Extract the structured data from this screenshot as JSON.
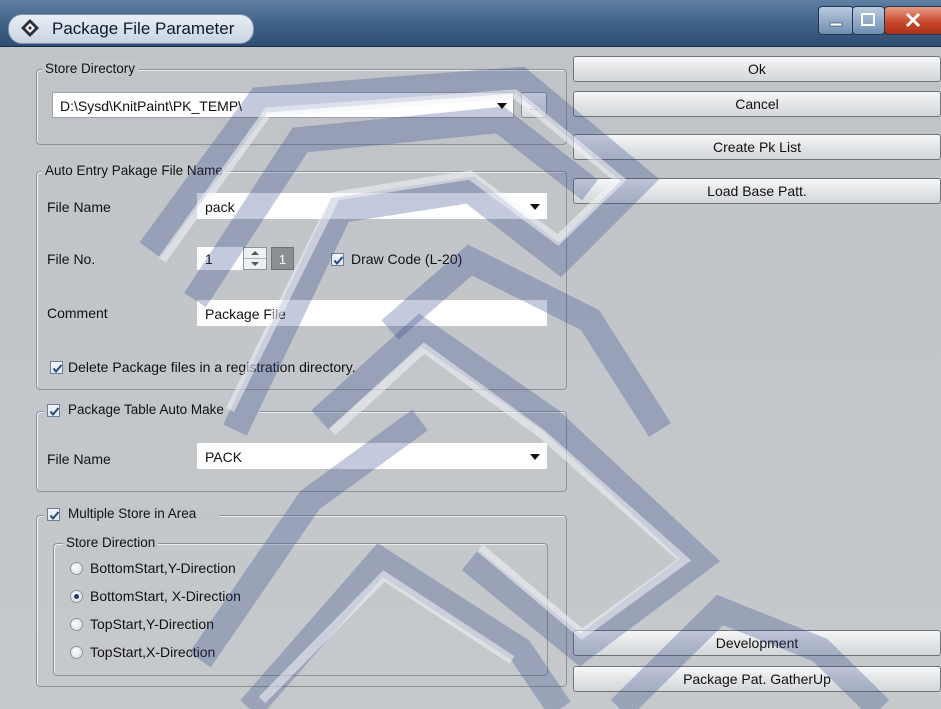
{
  "window": {
    "title": "Package File Parameter"
  },
  "store_directory": {
    "legend": "Store Directory",
    "path": "D:\\Sysd\\KnitPaint\\PK_TEMP\\",
    "browse_label": "..."
  },
  "auto_entry": {
    "legend": "Auto Entry Pakage File Name",
    "file_name_label": "File Name",
    "file_name_value": "pack",
    "file_no_label": "File No.",
    "file_no_value": "1",
    "file_no_badge": "1",
    "draw_code_label": "Draw Code (L-20)",
    "draw_code_checked": true,
    "comment_label": "Comment",
    "comment_value": "Package File",
    "delete_label": "Delete Package files in a registration directory.",
    "delete_checked": true
  },
  "package_table": {
    "legend": "Package Table Auto Make",
    "checked": true,
    "file_name_label": "File Name",
    "file_name_value": "PACK"
  },
  "multiple_store": {
    "legend": "Multiple Store in Area",
    "checked": true,
    "direction_legend": "Store Direction",
    "options": [
      {
        "label": "BottomStart,Y-Direction",
        "selected": false
      },
      {
        "label": "BottomStart, X-Direction",
        "selected": true
      },
      {
        "label": "TopStart,Y-Direction",
        "selected": false
      },
      {
        "label": "TopStart,X-Direction",
        "selected": false
      }
    ]
  },
  "buttons": {
    "ok": "Ok",
    "cancel": "Cancel",
    "create_pk_list": "Create Pk List",
    "load_base_patt": "Load Base Patt.",
    "development": "Development",
    "package_gather": "Package Pat. GatherUp"
  },
  "colors": {
    "titlebar": "#3e5f85",
    "dialog_bg": "#c3c6c9",
    "watermark": "#2c3f8a"
  },
  "icons": [
    "app-diamond-icon",
    "minimize-icon",
    "maximize-icon",
    "close-icon",
    "chevron-down-icon",
    "checkmark-icon",
    "spin-up-icon",
    "spin-down-icon"
  ]
}
